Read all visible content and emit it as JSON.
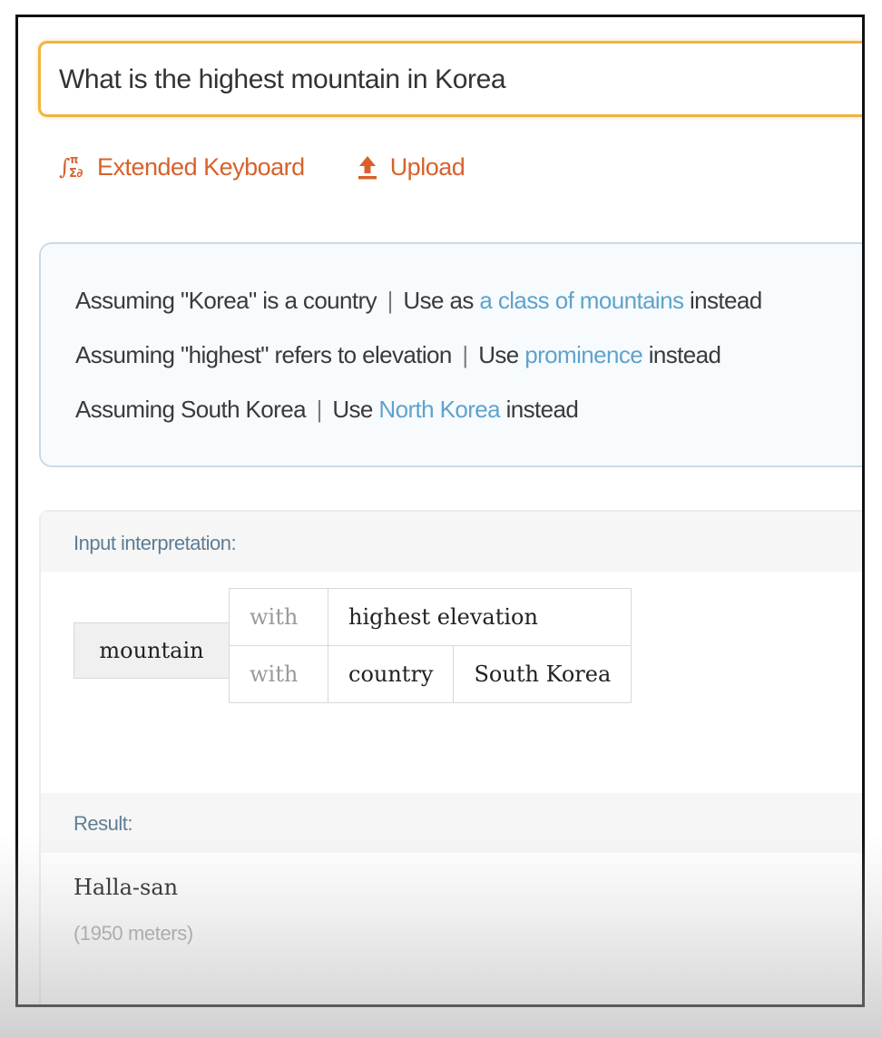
{
  "search": {
    "query": "What is the highest mountain in Korea"
  },
  "tools": {
    "extended_keyboard_label": "Extended Keyboard",
    "upload_label": "Upload"
  },
  "assumptions": [
    {
      "prefix": "Assuming \"Korea\" is a country",
      "sep": "|",
      "use": "Use as",
      "link": "a class of mountains",
      "suffix": "instead"
    },
    {
      "prefix": "Assuming \"highest\" refers to elevation",
      "sep": "|",
      "use": "Use",
      "link": "prominence",
      "suffix": "instead"
    },
    {
      "prefix": "Assuming South Korea",
      "sep": "|",
      "use": "Use",
      "link": "North Korea",
      "suffix": "instead"
    }
  ],
  "input_interpretation": {
    "title": "Input interpretation:",
    "entity": "mountain",
    "rows": [
      {
        "with": "with",
        "property": "highest elevation",
        "value": ""
      },
      {
        "with": "with",
        "property": "country",
        "value": "South Korea"
      }
    ]
  },
  "result": {
    "title": "Result:",
    "name": "Halla-san",
    "detail": "(1950 meters)"
  },
  "colors": {
    "accent_orange": "#d8612b",
    "search_border": "#f0b440",
    "link_blue": "#5fa3cc",
    "pod_title": "#5f7d93"
  }
}
